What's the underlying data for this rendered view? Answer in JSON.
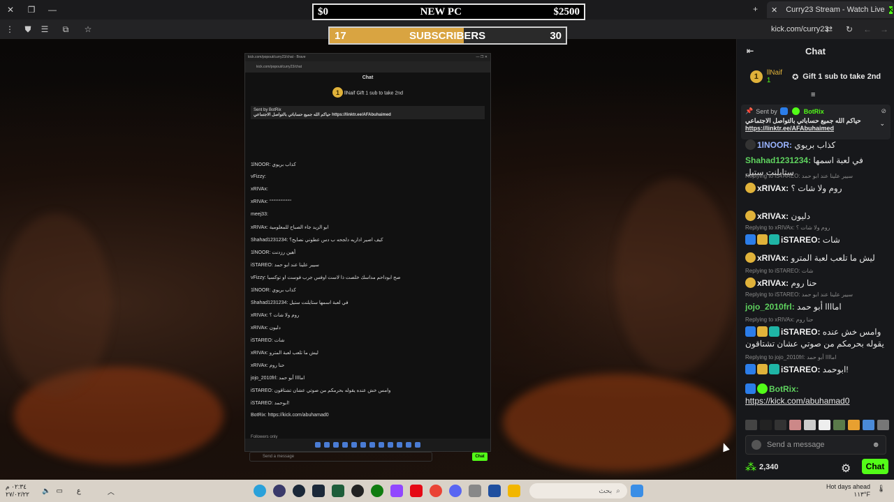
{
  "browser": {
    "tab_title": "Curry23 Stream - Watch Live",
    "url": "kick.com/curry23",
    "new_tab_symbol": "+",
    "close_symbol": "✕"
  },
  "overlay": {
    "goal_start": "$0",
    "goal_title": "NEW PC",
    "goal_end": "$2500",
    "sub_current": "17",
    "sub_label": "SUBSCRIBERS",
    "sub_target": "30",
    "sub_progress": 0.567
  },
  "monitor": {
    "title": "kick.com/popout/curry23/chat - Brave",
    "url": "kick.com/popout/curry23/chat",
    "chat_title": "Chat",
    "top_gifter": "llNaif",
    "gift_text": "Gift 1 sub to take 2nd",
    "pinned_by": "Sent by BotRix",
    "pinned_text": "حياكم الله جميع حساباتي بالتواصل الاجتماعي https://linktr.ee/AFAbuhaimed",
    "lines": [
      "1lNOOR: كذاب بريوي",
      "vFizzy:",
      "xRIVAx:",
      "xRIVAx: ‘‘‘‘‘‘‘‘‘‘‘‘‘‘‘‘‘‘‘‘‘‘",
      "meej33:",
      "xRIVAx: ابو الزيد جاء الصباح للمعلومية",
      "Shahad1231234: كيف اصير اداريه دلجحه ب دس عطوني نصايح؟",
      "1lNOOR: أهين رزدنت",
      "iSTAREO: سيير علينا عند ابو حمد",
      "vFizzy: صح ابوداحم مداسك خلصت ذا لاست اوفس جرب فوست او توكسيا",
      "1lNOOR: كذاب بريوي",
      "Shahad1231234: في لعبة اسمها ستايلنت ستيل",
      "xRIVAx: روم ولا شات ؟",
      "xRIVAx: دليون",
      "iSTAREO: شات",
      "xRIVAx: ليش ما تلعب لعبة المترو",
      "xRIVAx: حنا روم",
      "jojo_2010frl: اماااا أبو حمد",
      "iSTAREO: وامس خش عنده يقوله بحرمكم من صوتي عشان تشتاقون",
      "iSTAREO: ابوحمد!",
      "BotRix: https://kick.com/abuhamad0"
    ],
    "followers_only": "Followers only",
    "send_placeholder": "Send a message",
    "chat_button": "Chat"
  },
  "chat": {
    "title": "Chat",
    "top_gifter": {
      "rank": "1",
      "name": "llNaif",
      "count": "1"
    },
    "gift_text": "Gift 1 sub to take 2nd",
    "pinned": {
      "sent_by": "Sent by",
      "author": "BotRix",
      "text": "حياكم الله جميع حساباتي بالتواصل الاجتماعي",
      "link": "https://linktr.ee/AFAbuhaimed"
    },
    "messages": [
      {
        "user": "1lNOOR",
        "text": "كذاب بريوي",
        "reply": ""
      },
      {
        "user": "Shahad1231234",
        "text": "في لعبة اسمها ستايلنت ستيل",
        "reply": ""
      },
      {
        "user": "xRIVAx",
        "text": "روم ولا شات ؟",
        "reply": "Replying to iSTAREO: سيير علينا عند ابو حمد"
      },
      {
        "user": "xRIVAx",
        "text": "دليون",
        "reply": ""
      },
      {
        "user": "iSTAREO",
        "text": "شات",
        "reply": "Replying to xRIVAx: روم ولا شات ؟"
      },
      {
        "user": "xRIVAx",
        "text": "ليش ما تلعب لعبة المترو",
        "reply": ""
      },
      {
        "user": "xRIVAx",
        "text": "حنا روم",
        "reply": "Replying to iSTAREO: شات"
      },
      {
        "user": "jojo_2010frl",
        "text": "اماااا أبو حمد",
        "reply": "Replying to iSTAREO: سيير علينا عند ابو حمد"
      },
      {
        "user": "iSTAREO",
        "text": "وامس خش عنده يقوله بحرمكم من صوتي عشان تشتاقون",
        "reply": "Replying to xRIVAx: حنا روم"
      },
      {
        "user": "iSTAREO",
        "text": "ابوحمد!",
        "reply": "Replying to jojo_2010frl: اماااا أبو حمد"
      },
      {
        "user": "BotRix",
        "text": "https://kick.com/abuhamad0",
        "reply": ""
      }
    ],
    "send_placeholder": "Send a message",
    "points": "2,340",
    "chat_button": "Chat"
  },
  "taskbar": {
    "time": "٠٢:٣٤ م",
    "date": "٢٧/٠٢/٢٢",
    "search_placeholder": "بحث",
    "weather_title": "Hot days ahead",
    "weather_temp": "١١٣°F",
    "lang": "ع"
  },
  "colors": {
    "kick_green": "#53fc18",
    "gold": "#d9a441",
    "user_green": "#5fd35f",
    "user_blue": "#4fa3ff"
  }
}
